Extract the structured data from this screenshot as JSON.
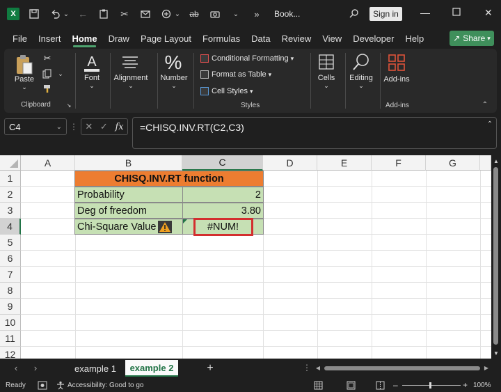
{
  "titlebar": {
    "app_icon": "excel-logo",
    "book_title": "Book...",
    "sign_in_label": "Sign in",
    "icons": [
      "save-icon",
      "undo-icon",
      "redo-icon",
      "paste-icon",
      "cut-icon",
      "email-icon",
      "strikethrough-icon",
      "camera-icon",
      "more-icon",
      "search-icon"
    ]
  },
  "menu": {
    "items": [
      "File",
      "Insert",
      "Home",
      "Draw",
      "Page Layout",
      "Formulas",
      "Data",
      "Review",
      "View",
      "Developer",
      "Help"
    ],
    "active": "Home",
    "share_label": "Share"
  },
  "ribbon": {
    "clipboard": {
      "paste_label": "Paste",
      "group_label": "Clipboard"
    },
    "font_label": "Font",
    "alignment_label": "Alignment",
    "number_label": "Number",
    "styles": {
      "conditional_formatting": "Conditional Formatting",
      "format_as_table": "Format as Table",
      "cell_styles": "Cell Styles",
      "group_label": "Styles"
    },
    "cells_label": "Cells",
    "editing_label": "Editing",
    "addins": {
      "button_label": "Add-ins",
      "group_label": "Add-ins"
    }
  },
  "formula_bar": {
    "name_box": "C4",
    "fx_label": "fx",
    "formula": "=CHISQ.INV.RT(C2,C3)"
  },
  "grid": {
    "columns": [
      "A",
      "B",
      "C",
      "D",
      "E",
      "F",
      "G"
    ],
    "selected_column": "C",
    "rows": [
      "1",
      "2",
      "3",
      "4",
      "5",
      "6",
      "7",
      "8",
      "9",
      "10",
      "11",
      "12"
    ],
    "selected_row": "4",
    "cells": {
      "title": "CHISQ.INV.RT function",
      "b2": "Probability",
      "c2": "2",
      "b3": "Deg of freedom",
      "c3": "3.80",
      "b4": "Chi-Square Value",
      "c4": "#NUM!"
    },
    "colors": {
      "header_fill": "#ed7d31",
      "data_fill": "#c6e0b4",
      "error_outline": "#d32f2f"
    }
  },
  "sheets": {
    "tabs": [
      "example 1",
      "example 2"
    ],
    "active": "example 2",
    "add_label": "+"
  },
  "status": {
    "ready": "Ready",
    "accessibility": "Accessibility: Good to go",
    "zoom": "100%"
  }
}
